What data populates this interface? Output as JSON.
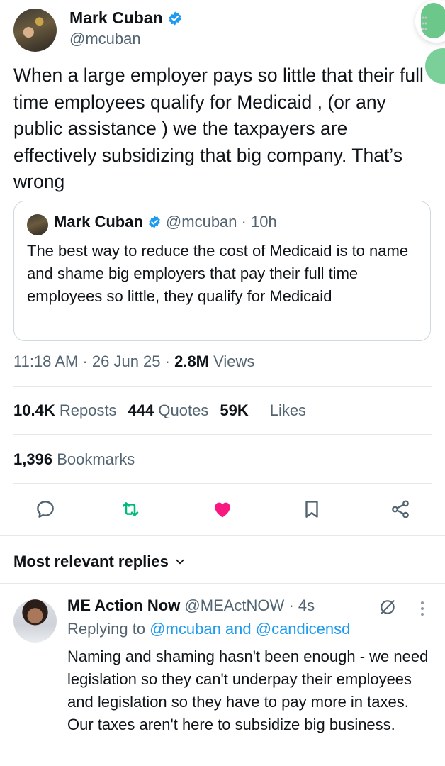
{
  "tweet": {
    "author_name": "Mark Cuban",
    "author_handle": "@mcuban",
    "text": "When a large employer pays so little that their full time employees qualify for Medicaid , (or any public assistance ) we the taxpayers are effectively subsidizing that big company. That’s wrong",
    "quote": {
      "author_name": "Mark Cuban",
      "author_handle": "@mcuban",
      "time": "· 10h",
      "text": "The best way to reduce the cost of Medicaid is to name and shame big employers that pay their full time employees so little, they qualify for Medicaid"
    },
    "meta": {
      "time": "11:18 AM",
      "date": "26 Jun 25",
      "views_count": "2.8M",
      "views_label": "Views"
    },
    "stats": {
      "reposts_count": "10.4K",
      "reposts_label": "Reposts",
      "quotes_count": "444",
      "quotes_label": "Quotes",
      "likes_count": "59K",
      "likes_label": "Likes",
      "bookmarks_count": "1,396",
      "bookmarks_label": "Bookmarks"
    },
    "actions": [
      "reply-icon",
      "repost-icon",
      "like-icon",
      "bookmark-icon",
      "share-icon"
    ],
    "colors": {
      "repost": "#00ba7c",
      "like": "#f91880",
      "verified": "#1d9bf0",
      "link": "#1d9bf0"
    }
  },
  "replies": {
    "sort_label": "Most relevant replies",
    "items": [
      {
        "author_name": "ME Action Now",
        "author_handle": "@MEActNOW",
        "time": "· 4s",
        "replying_prefix": "Replying to",
        "replying_targets": "@mcuban and @candicensd",
        "text": "Naming and shaming hasn't been enough - we need legislation so they can't underpay their employees and legislation so they have to pay more in taxes. Our taxes aren't here to subsidize big business."
      }
    ]
  }
}
